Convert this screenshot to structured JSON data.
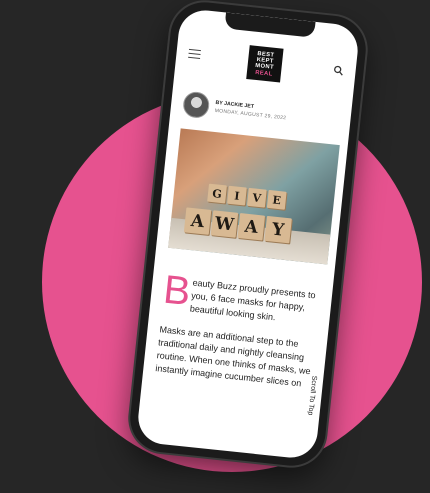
{
  "logo": {
    "lines": [
      "BEST",
      "KEPT",
      "MONT",
      "REAL"
    ]
  },
  "post": {
    "author_prefix": "BY",
    "author": "JACKIE JET",
    "date": "MONDAY, AUGUST 29, 2022",
    "hero_words": [
      "GIVE",
      "AWAY"
    ],
    "drop_cap": "B",
    "lead": "eauty Buzz proudly presents to you, 6 face masks for happy, beautiful looking skin.",
    "body": "Masks are an additional step to the traditional daily and nightly cleansing routine. When one thinks of masks, we instantly imagine cucumber slices on"
  },
  "scroll_top_label": "Scroll To Top",
  "icons": {
    "menu": "hamburger-icon",
    "search": "search-icon"
  },
  "colors": {
    "background": "#262626",
    "accent": "#e6528f"
  }
}
